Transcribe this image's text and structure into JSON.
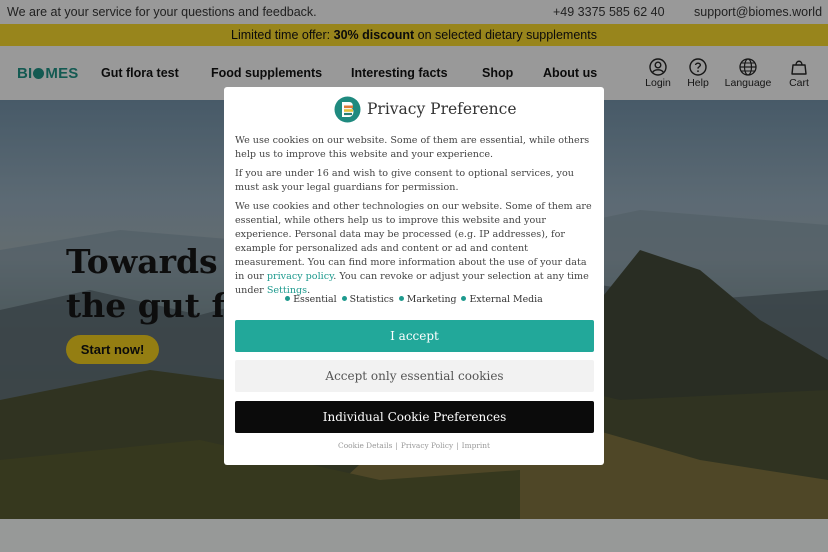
{
  "topbar": {
    "service_text": "We are at your service for your questions and feedback.",
    "phone": "+49 3375 585 62 40",
    "email": "support@biomes.world"
  },
  "promo": {
    "prefix": "Limited time offer: ",
    "highlight": "30% discount",
    "suffix": " on selected dietary supplements"
  },
  "nav": {
    "logo": "BIOMES",
    "items": [
      "Gut flora test",
      "Food supplements",
      "Interesting facts",
      "Shop",
      "About us"
    ],
    "icons": [
      {
        "label": "Login",
        "icon": "user-icon"
      },
      {
        "label": "Help",
        "icon": "question-icon"
      },
      {
        "label": "Language",
        "icon": "globe-icon"
      },
      {
        "label": "Cart",
        "icon": "bag-icon"
      }
    ]
  },
  "hero": {
    "title_line1": "Towards a",
    "title_line2": "the gut flo",
    "cta": "Start now!"
  },
  "modal": {
    "title": "Privacy Preference",
    "p1": "We use cookies on our website. Some of them are essential, while others help us to improve this website and your experience.",
    "p2": "If you are under 16 and wish to give consent to optional services, you must ask your legal guardians for permission.",
    "p3_before": "We use cookies and other technologies on our website. Some of them are essential, while others help us to improve this website and your experience. Personal data may be processed (e.g. IP addresses), for example for personalized ads and content or ad and content measurement. You can find more information about the use of your data in our ",
    "p3_link": "privacy policy",
    "p3_middle": ". You can revoke or adjust your selection at any time under ",
    "p3_link2": "Settings",
    "p3_end": ".",
    "categories": [
      "Essential",
      "Statistics",
      "Marketing",
      "External Media"
    ],
    "btn_accept": "I accept",
    "btn_essential": "Accept only essential cookies",
    "btn_individual": "Individual Cookie Preferences",
    "footer": [
      "Cookie Details",
      "Privacy Policy",
      "Imprint"
    ],
    "accent_color": "#22a89a"
  }
}
